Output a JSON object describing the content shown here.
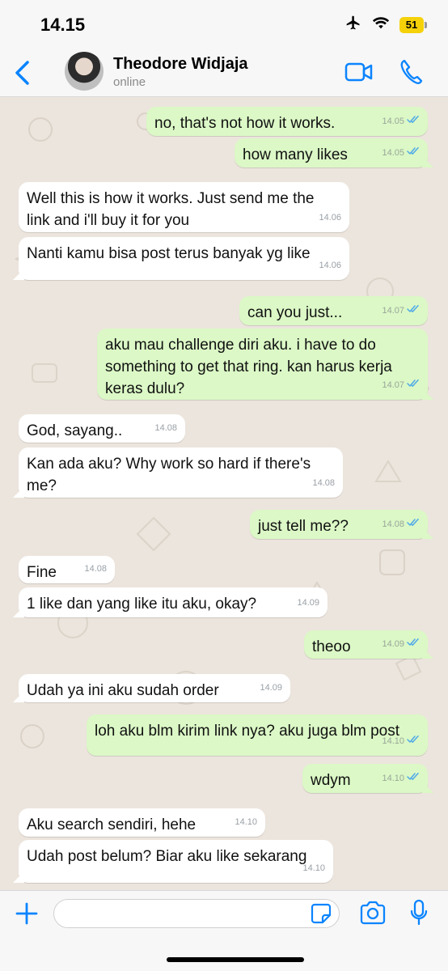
{
  "status": {
    "time": "14.15",
    "battery": "51"
  },
  "header": {
    "name": "Theodore Widjaja",
    "status": "online"
  },
  "colors": {
    "accent": "#0b84ff",
    "outgoing": "#dbf8c6",
    "incoming": "#ffffff",
    "ticks": "#4fa9e8"
  },
  "messages": [
    {
      "dir": "out",
      "lines": [
        "no, that's not how it works."
      ],
      "time": "14.05",
      "read": true
    },
    {
      "dir": "out",
      "lines": [
        "how many likes"
      ],
      "time": "14.05",
      "read": true
    },
    {
      "dir": "in",
      "lines": [
        "Well this is how it works. Just send me the",
        "link and i'll buy it for you"
      ],
      "time": "14.06"
    },
    {
      "dir": "in",
      "lines": [
        "Nanti kamu bisa post terus banyak yg like"
      ],
      "time": "14.06"
    },
    {
      "dir": "out",
      "lines": [
        "can you just..."
      ],
      "time": "14.07",
      "read": true
    },
    {
      "dir": "out",
      "lines": [
        "aku mau challenge diri aku. i have to do",
        "something to get that ring. kan harus kerja",
        "keras dulu?"
      ],
      "time": "14.07",
      "read": true
    },
    {
      "dir": "in",
      "lines": [
        "God, sayang.."
      ],
      "time": "14.08"
    },
    {
      "dir": "in",
      "lines": [
        "Kan ada aku? Why work so hard if there's",
        "me?"
      ],
      "time": "14.08"
    },
    {
      "dir": "out",
      "lines": [
        "just tell me??"
      ],
      "time": "14.08",
      "read": true
    },
    {
      "dir": "in",
      "lines": [
        "Fine"
      ],
      "time": "14.08"
    },
    {
      "dir": "in",
      "lines": [
        "1 like dan yang like itu aku, okay?"
      ],
      "time": "14.09"
    },
    {
      "dir": "out",
      "lines": [
        "theoo"
      ],
      "time": "14.09",
      "read": true
    },
    {
      "dir": "in",
      "lines": [
        "Udah ya ini aku sudah order"
      ],
      "time": "14.09"
    },
    {
      "dir": "out",
      "lines": [
        "loh aku blm kirim link nya? aku juga blm post"
      ],
      "time": "14.10",
      "read": true
    },
    {
      "dir": "out",
      "lines": [
        "wdym"
      ],
      "time": "14.10",
      "read": true
    },
    {
      "dir": "in",
      "lines": [
        "Aku search sendiri, hehe"
      ],
      "time": "14.10"
    },
    {
      "dir": "in",
      "lines": [
        "Udah post belum? Biar aku like sekarang"
      ],
      "time": "14.10"
    }
  ],
  "input": {
    "placeholder": ""
  }
}
